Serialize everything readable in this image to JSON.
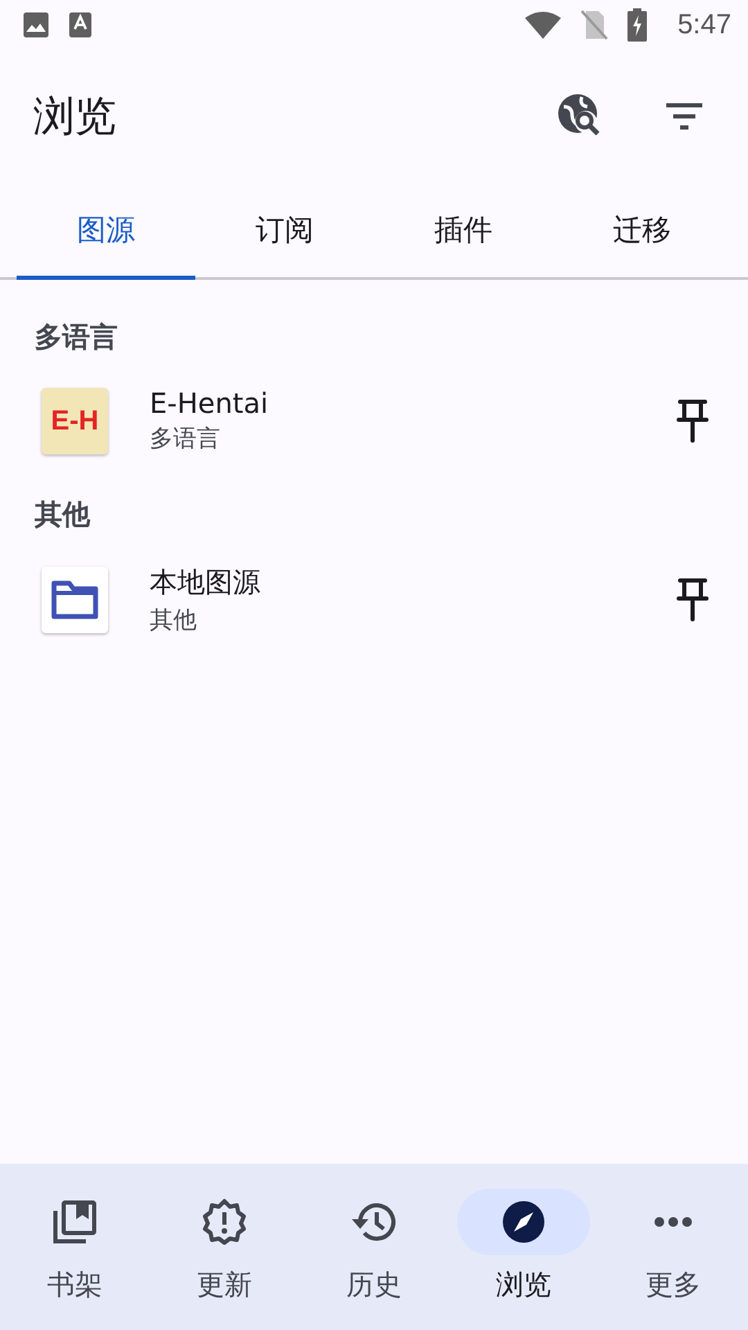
{
  "status_bar": {
    "time": "5:47"
  },
  "app_bar": {
    "title": "浏览"
  },
  "tabs": [
    {
      "label": "图源",
      "selected": true
    },
    {
      "label": "订阅",
      "selected": false
    },
    {
      "label": "插件",
      "selected": false
    },
    {
      "label": "迁移",
      "selected": false
    }
  ],
  "sections": [
    {
      "header": "多语言",
      "items": [
        {
          "kind": "logo",
          "logo_text": "E-H",
          "name": "E-Hentai",
          "language": "多语言",
          "pinned": false
        }
      ]
    },
    {
      "header": "其他",
      "items": [
        {
          "kind": "folder",
          "name": "本地图源",
          "language": "其他",
          "pinned": false
        }
      ]
    }
  ],
  "bottom_nav": [
    {
      "label": "书架",
      "selected": false
    },
    {
      "label": "更新",
      "selected": false
    },
    {
      "label": "历史",
      "selected": false
    },
    {
      "label": "浏览",
      "selected": true
    },
    {
      "label": "更多",
      "selected": false
    }
  ]
}
